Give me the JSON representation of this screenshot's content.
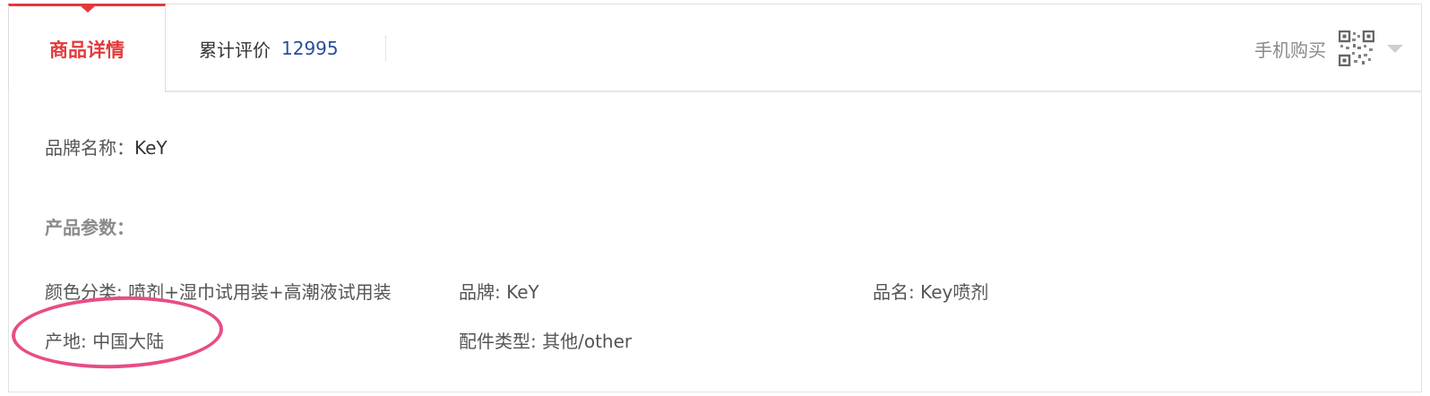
{
  "tabs": {
    "detail_label": "商品详情",
    "review_label": "累计评价",
    "review_count": "12995",
    "mobile_buy_label": "手机购买"
  },
  "brand": {
    "label": "品牌名称：",
    "value": "KeY"
  },
  "params": {
    "title": "产品参数：",
    "items": [
      "颜色分类: 喷剂+湿巾试用装+高潮液试用装",
      "品牌: KeY",
      "品名: Key喷剂",
      "产地: 中国大陆",
      "配件类型: 其他/other"
    ]
  },
  "colors": {
    "accent": "#e4393c",
    "count": "#2a4d9c",
    "annotation": "#e84c86"
  }
}
